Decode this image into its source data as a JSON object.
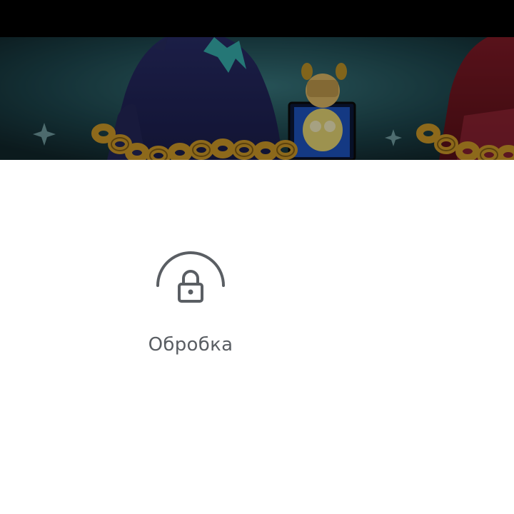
{
  "status": {
    "label": "Обробка",
    "icon": "lock-icon",
    "color": "#5a5e63"
  },
  "banner": {
    "description_icon": "game-artwork-banner"
  }
}
